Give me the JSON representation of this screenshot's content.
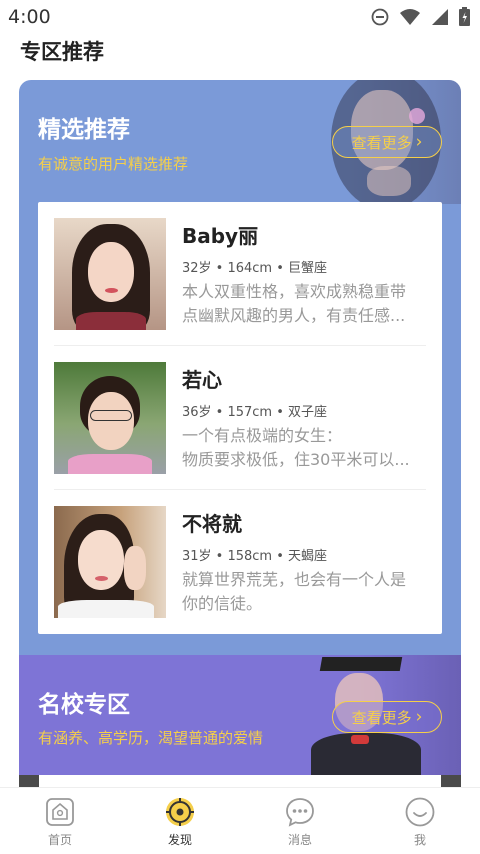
{
  "status_bar": {
    "time": "4:00"
  },
  "page_title": "专区推荐",
  "featured": {
    "heading": "精选推荐",
    "subheading": "有诚意的用户精选推荐",
    "more_label": "查看更多",
    "profiles": [
      {
        "name": "Baby丽",
        "meta": "32岁 • 164cm • 巨蟹座",
        "desc_line1": "本人双重性格，喜欢成熟稳重带",
        "desc_line2": "点幽默风趣的男人，有责任感..."
      },
      {
        "name": "若心",
        "meta": "36岁 • 157cm • 双子座",
        "desc_line1": "一个有点极端的女生：",
        "desc_line2": "物质要求极低，住30平米可以..."
      },
      {
        "name": "不将就",
        "meta": "31岁 • 158cm • 天蝎座",
        "desc_line1": "就算世界荒芜，也会有一个人是",
        "desc_line2": "你的信徒。"
      }
    ]
  },
  "school": {
    "heading": "名校专区",
    "subheading": "有涵养、高学历，渴望普通的爱情",
    "more_label": "查看更多"
  },
  "bottom_nav": {
    "items": [
      {
        "label": "首页",
        "icon": "home-icon"
      },
      {
        "label": "发现",
        "icon": "discover-icon"
      },
      {
        "label": "消息",
        "icon": "message-icon"
      },
      {
        "label": "我",
        "icon": "me-icon"
      }
    ],
    "active": "发现"
  },
  "colors": {
    "featured_bg": "#7b9ad8",
    "school_bg": "#7e74d6",
    "accent_yellow": "#f5cf4a"
  }
}
